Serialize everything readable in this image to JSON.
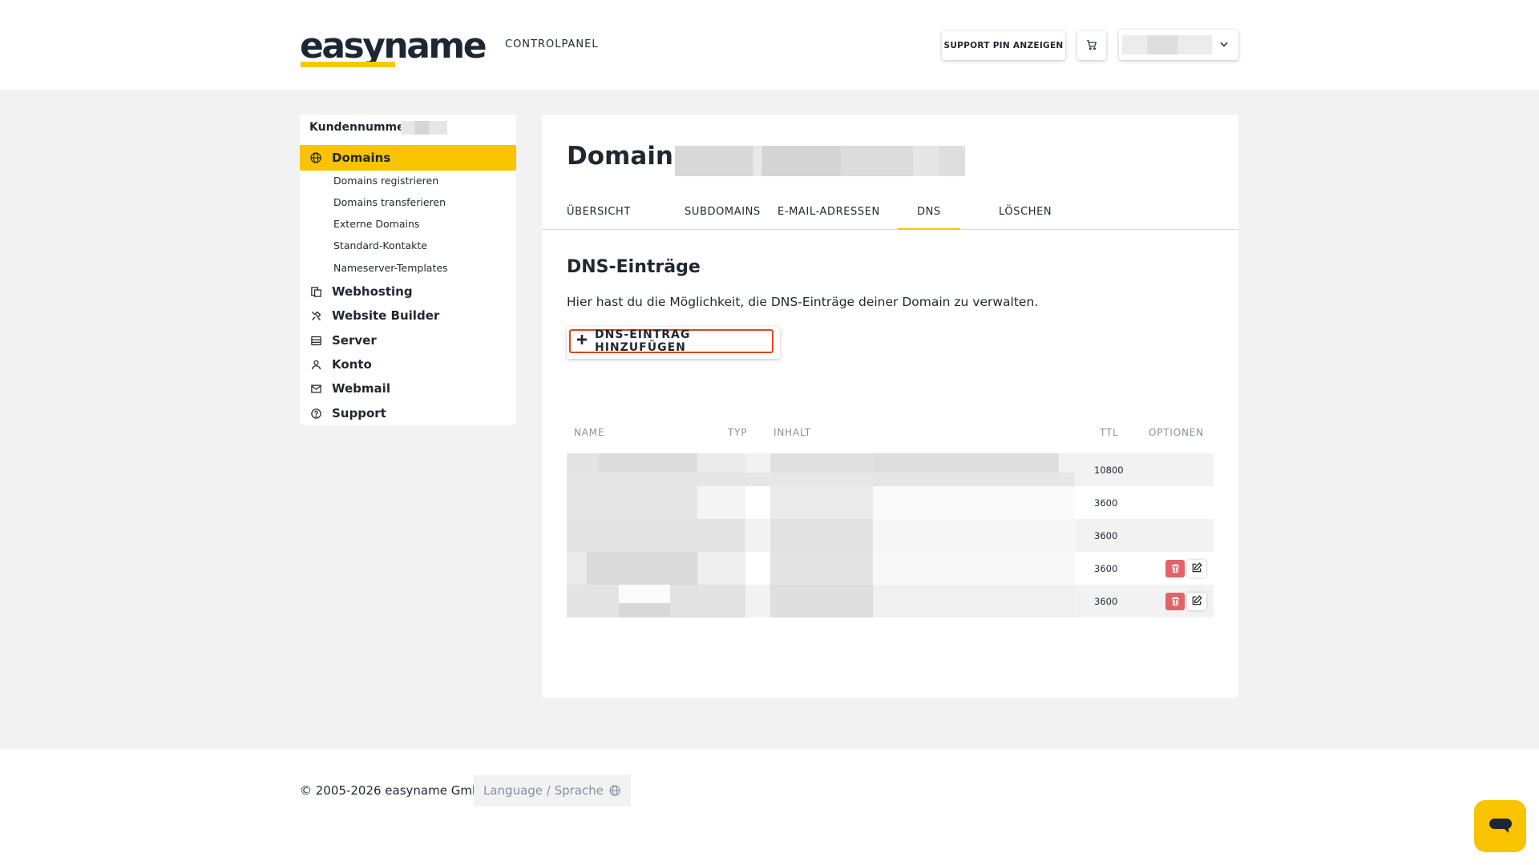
{
  "header": {
    "logo_text": "easyname",
    "logo_sub": "CONTROLPANEL",
    "support_pin_label": "SUPPORT PIN ANZEIGEN",
    "brand_color": "#f9c300"
  },
  "sidebar": {
    "customer_label": "Kundennummer:",
    "active_item": {
      "label": "Domains",
      "icon": "globe-icon"
    },
    "sub_items": [
      "Domains registrieren",
      "Domains transferieren",
      "Externe Domains",
      "Standard-Kontakte",
      "Nameserver-Templates"
    ],
    "items": [
      {
        "label": "Webhosting",
        "icon": "webhosting-icon"
      },
      {
        "label": "Website Builder",
        "icon": "website-builder-icon"
      },
      {
        "label": "Server",
        "icon": "server-icon"
      },
      {
        "label": "Konto",
        "icon": "user-icon"
      },
      {
        "label": "Webmail",
        "icon": "mail-icon"
      },
      {
        "label": "Support",
        "icon": "help-icon"
      }
    ]
  },
  "main": {
    "domain_label": "Domain:",
    "tabs": [
      "ÜBERSICHT",
      "SUBDOMAINS",
      "E-MAIL-ADRESSEN",
      "DNS",
      "LÖSCHEN"
    ],
    "active_tab": "DNS",
    "section_title": "DNS-Einträge",
    "section_desc": "Hier hast du die Möglichkeit, die DNS-Einträge deiner Domain zu verwalten.",
    "add_button_label": "DNS-EINTRAG HINZUFÜGEN",
    "table": {
      "headers": {
        "name": "NAME",
        "type": "TYP",
        "content": "INHALT",
        "ttl": "TTL",
        "options": "OPTIONEN"
      },
      "rows": [
        {
          "ttl": "10800",
          "editable": false
        },
        {
          "ttl": "3600",
          "editable": false
        },
        {
          "ttl": "3600",
          "editable": false
        },
        {
          "ttl": "3600",
          "editable": true
        },
        {
          "ttl": "3600",
          "editable": true
        }
      ]
    }
  },
  "footer": {
    "copyright": "© 2005-2026 easyname GmbH",
    "language_label": "Language / Sprache"
  }
}
